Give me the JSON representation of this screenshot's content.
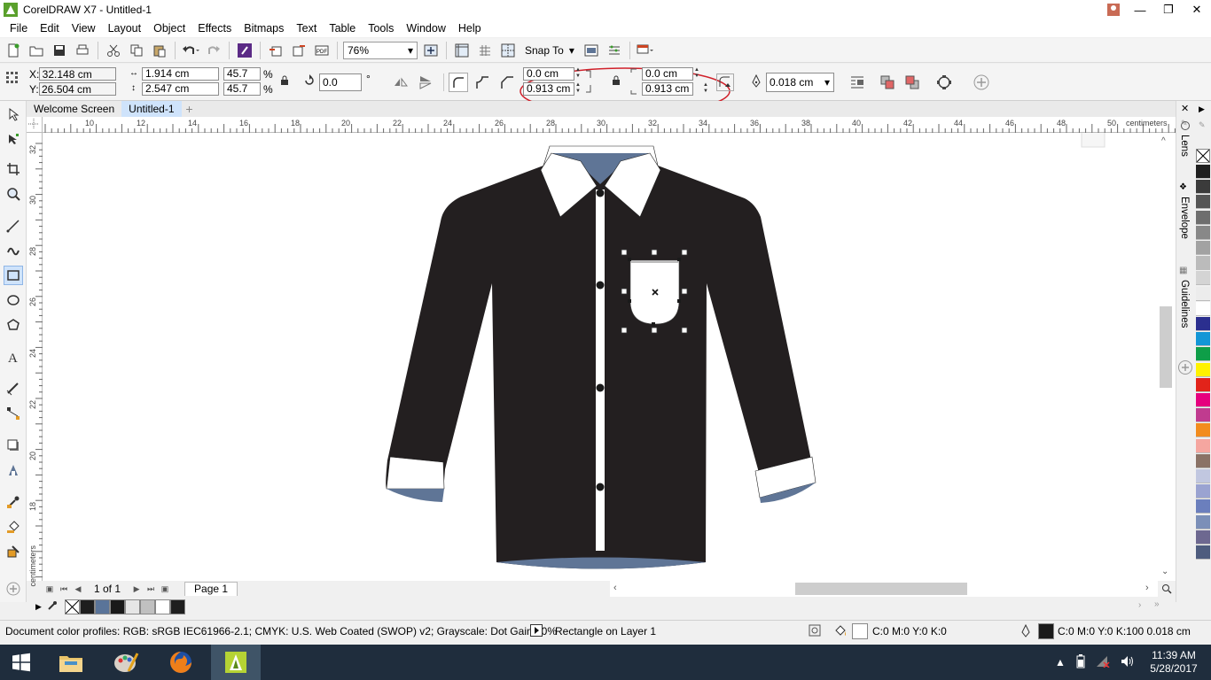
{
  "window": {
    "title": "CorelDRAW X7 - Untitled-1"
  },
  "menu": [
    "File",
    "Edit",
    "View",
    "Layout",
    "Object",
    "Effects",
    "Bitmaps",
    "Text",
    "Table",
    "Tools",
    "Window",
    "Help"
  ],
  "toolbar": {
    "zoom": "76%",
    "snap_to": "Snap To"
  },
  "properties": {
    "x": "X: 32.148 cm",
    "y": "Y: 26.504 cm",
    "width": "1.914 cm",
    "height": "2.547 cm",
    "scale_x": "45.7",
    "scale_y": "45.7",
    "percent": "%",
    "rotation": "0.0",
    "degree": "°",
    "corner_tl": "0.0 cm",
    "corner_bl": "0.913 cm",
    "corner_tr": "0.0 cm",
    "corner_br": "0.913 cm",
    "outline_width": "0.018 cm"
  },
  "tabs": [
    "Welcome Screen",
    "Untitled-1"
  ],
  "ruler": {
    "unit": "centimeters",
    "h_ticks": [
      "10",
      "12",
      "14",
      "16",
      "18",
      "20",
      "22",
      "24",
      "26",
      "28",
      "30",
      "32",
      "34",
      "36",
      "38",
      "40",
      "42",
      "44",
      "46",
      "48",
      "50"
    ],
    "v_ticks": [
      "32",
      "30",
      "28",
      "26",
      "24",
      "22",
      "20",
      "18"
    ]
  },
  "dockers": [
    "Lens",
    "Envelope",
    "Guidelines"
  ],
  "page_nav": {
    "counter": "1 of 1",
    "page_tab": "Page 1"
  },
  "palette_colors": [
    "#1e1e1e",
    "#3b3b3b",
    "#555555",
    "#6e6e6e",
    "#888888",
    "#a2a2a2",
    "#bbbbbb",
    "#d4d4d4",
    "#ececec",
    "#ffffff",
    "#2b2f8f",
    "#1296d6",
    "#0e9e48",
    "#fff200",
    "#e2231a",
    "#e6007e",
    "#c03b8f",
    "#f28c1e",
    "#f5a6a0",
    "#8a7266",
    "#c1c7e0",
    "#9aa3d1",
    "#6b7fbd",
    "#7b8fb8",
    "#6d6890",
    "#4e5c7e"
  ],
  "doc_palette_colors": [
    "#1e1e1e",
    "#5a7499",
    "#1a1a1a",
    "#e6e6e6",
    "#c0c0c0",
    "#ffffff",
    "#1e1e1e"
  ],
  "status": {
    "color_profiles": "Document color profiles: RGB: sRGB IEC61966-2.1; CMYK: U.S. Web Coated (SWOP) v2; Grayscale: Dot Gain 20%",
    "object_info": "Rectangle on Layer 1",
    "fill_info": "C:0 M:0 Y:0 K:0",
    "outline_info": "C:0 M:0 Y:0 K:100  0.018 cm"
  },
  "colors": {
    "shirt_body": "#231f20",
    "collar_inner": "#5f7596",
    "highlight_circle": "#d0202a",
    "selection": "#1a1a1a"
  },
  "taskbar": {
    "time": "11:39 AM",
    "date": "5/28/2017"
  }
}
